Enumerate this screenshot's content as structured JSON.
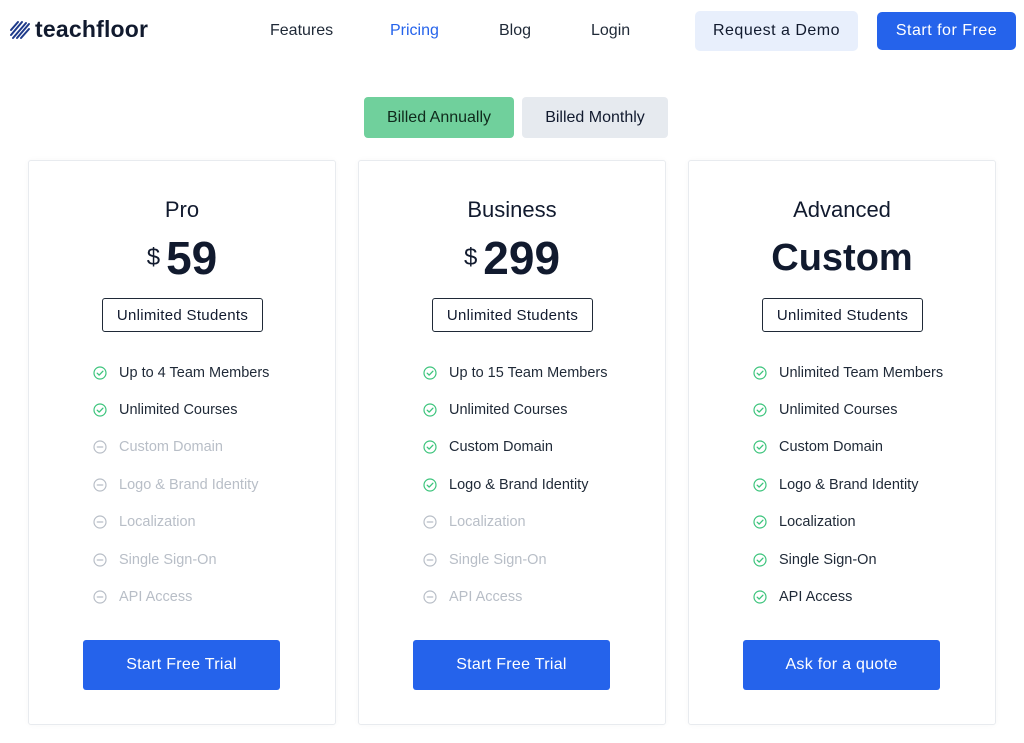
{
  "brand": {
    "name": "teachfloor"
  },
  "nav": {
    "features": "Features",
    "pricing": "Pricing",
    "blog": "Blog",
    "login": "Login",
    "request_demo": "Request a Demo",
    "start_free": "Start for Free"
  },
  "billing": {
    "annual": "Billed Annually",
    "monthly": "Billed Monthly"
  },
  "colors": {
    "accent": "#2563eb",
    "toggle_active": "#70d09c",
    "check": "#3cc47c",
    "disabled": "#b8bec7"
  },
  "plans": [
    {
      "name": "Pro",
      "currency": "$",
      "price": "59",
      "students": "Unlimited Students",
      "features": [
        {
          "label": "Up to 4 Team Members",
          "included": true
        },
        {
          "label": "Unlimited Courses",
          "included": true
        },
        {
          "label": "Custom Domain",
          "included": false
        },
        {
          "label": "Logo & Brand Identity",
          "included": false
        },
        {
          "label": "Localization",
          "included": false
        },
        {
          "label": "Single Sign-On",
          "included": false
        },
        {
          "label": "API Access",
          "included": false
        }
      ],
      "cta": "Start Free Trial"
    },
    {
      "name": "Business",
      "currency": "$",
      "price": "299",
      "students": "Unlimited Students",
      "features": [
        {
          "label": "Up to 15 Team Members",
          "included": true
        },
        {
          "label": "Unlimited Courses",
          "included": true
        },
        {
          "label": "Custom Domain",
          "included": true
        },
        {
          "label": "Logo & Brand Identity",
          "included": true
        },
        {
          "label": "Localization",
          "included": false
        },
        {
          "label": "Single Sign-On",
          "included": false
        },
        {
          "label": "API Access",
          "included": false
        }
      ],
      "cta": "Start Free Trial"
    },
    {
      "name": "Advanced",
      "currency": "",
      "price": "Custom",
      "students": "Unlimited Students",
      "features": [
        {
          "label": "Unlimited Team Members",
          "included": true
        },
        {
          "label": "Unlimited Courses",
          "included": true
        },
        {
          "label": "Custom Domain",
          "included": true
        },
        {
          "label": "Logo & Brand Identity",
          "included": true
        },
        {
          "label": "Localization",
          "included": true
        },
        {
          "label": "Single Sign-On",
          "included": true
        },
        {
          "label": "API Access",
          "included": true
        }
      ],
      "cta": "Ask for a quote"
    }
  ]
}
